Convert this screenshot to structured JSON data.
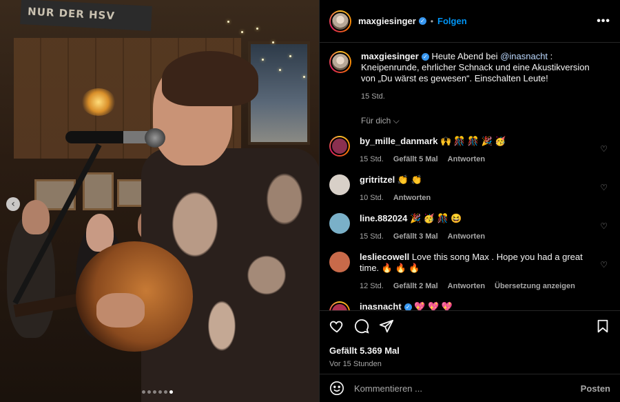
{
  "photo": {
    "sign_text": "NUR DER HSV",
    "prev_arrow": "‹",
    "carousel": {
      "count": 6,
      "active_index": 5
    }
  },
  "post": {
    "author": "maxgiesinger",
    "separator": "•",
    "follow_label": "Folgen",
    "more_label": "•••",
    "caption": {
      "text_before": " Heute Abend bei ",
      "mention": "@inasnacht",
      "text_after": " : Kneipenrunde, ehrlicher Schnack und eine Akustikversion von „Du wärst es gewesen“. Einschalten Leute!",
      "time": "15 Std."
    },
    "filter_label": "Für dich ⌵",
    "comments": [
      {
        "user": "by_mille_danmark",
        "text": " 🙌 🎊 🎊 🎉 🥳",
        "time": "15 Std.",
        "likes": "Gefällt 5 Mal",
        "reply": "Antworten",
        "avatar_color": "#8a3050"
      },
      {
        "user": "gritritzel",
        "text": " 👏 👏",
        "time": "10 Std.",
        "likes": "",
        "reply": "Antworten",
        "avatar_color": "#d8d0c8"
      },
      {
        "user": "line.882024",
        "text": " 🎉 🥳 🎊 😆",
        "time": "15 Std.",
        "likes": "Gefällt 3 Mal",
        "reply": "Antworten",
        "avatar_color": "#7ab0c8"
      },
      {
        "user": "lesliecowell",
        "text": " Love this song Max . Hope you had a great time. 🔥 🔥 🔥",
        "time": "12 Std.",
        "likes": "Gefällt 2 Mal",
        "reply": "Antworten",
        "translate": "Übersetzung anzeigen",
        "avatar_color": "#c86a4a"
      },
      {
        "user": "inasnacht",
        "text": " 💖 💖 💖",
        "time": "",
        "likes": "",
        "reply": "",
        "avatar_color": "#b03050"
      }
    ],
    "heart_icon_small": "♡",
    "likes_total": "Gefällt 5.369 Mal",
    "posted_ago": "Vor 15 Stunden",
    "comment_placeholder": "Kommentieren ...",
    "post_label": "Posten"
  }
}
